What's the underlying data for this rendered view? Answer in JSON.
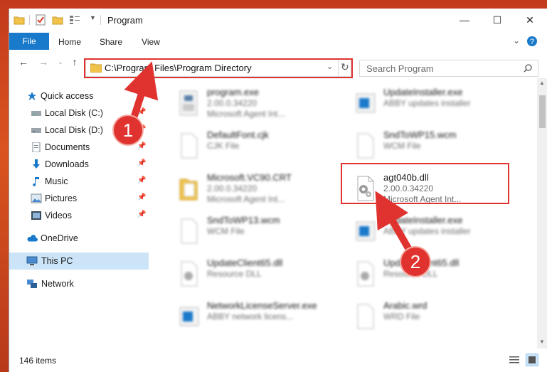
{
  "window": {
    "title": "Program",
    "controls": {
      "minimize": "—",
      "maximize": "☐",
      "close": "✕"
    }
  },
  "ribbon": {
    "tabs": [
      "File",
      "Home",
      "Share",
      "View"
    ],
    "collapse_icon": "chevron-down-icon",
    "help_icon": "help-icon"
  },
  "address": {
    "path": "C:\\Program Files\\Program Directory",
    "search_placeholder": "Search Program"
  },
  "sidebar": {
    "items": [
      {
        "label": "Quick access",
        "icon": "star-icon",
        "pinned": false
      },
      {
        "label": "Local Disk (C:)",
        "icon": "drive-icon",
        "pinned": true
      },
      {
        "label": "Local Disk (D:)",
        "icon": "drive-icon",
        "pinned": true
      },
      {
        "label": "Documents",
        "icon": "documents-icon",
        "pinned": true
      },
      {
        "label": "Downloads",
        "icon": "download-icon",
        "pinned": true
      },
      {
        "label": "Music",
        "icon": "music-icon",
        "pinned": true
      },
      {
        "label": "Pictures",
        "icon": "pictures-icon",
        "pinned": true
      },
      {
        "label": "Videos",
        "icon": "videos-icon",
        "pinned": true
      },
      {
        "label": "OneDrive",
        "icon": "cloud-icon",
        "pinned": false
      },
      {
        "label": "This PC",
        "icon": "computer-icon",
        "pinned": false,
        "selected": true
      },
      {
        "label": "Network",
        "icon": "network-icon",
        "pinned": false
      }
    ]
  },
  "files": {
    "left": [
      {
        "name": "program.exe",
        "line1": "2.00.0.34220",
        "line2": "Microsoft Agent Int..."
      },
      {
        "name": "DefaultFont.cjk",
        "line1": "CJK File",
        "line2": ""
      },
      {
        "name": "Microsoft.VC90.CRT",
        "line1": "2.00.0.34220",
        "line2": "Microsoft Agent Int..."
      },
      {
        "name": "SndToWP13.wcm",
        "line1": "WCM File",
        "line2": ""
      },
      {
        "name": "UpdateClient65.dll",
        "line1": "Resource DLL",
        "line2": ""
      },
      {
        "name": "NetworkLicenseServer.exe",
        "line1": "ABBY network licens...",
        "line2": ""
      }
    ],
    "right": [
      {
        "name": "UpdateInstaller.exe",
        "line1": "ABBY updates installer",
        "line2": ""
      },
      {
        "name": "SndToWP15.wcm",
        "line1": "WCM File",
        "line2": ""
      },
      {
        "name": "agt040b.dll",
        "line1": "2.00.0.34220",
        "line2": "Microsoft Agent Int..."
      },
      {
        "name": "UpdateInstaller.exe",
        "line1": "ABBY updates installer",
        "line2": ""
      },
      {
        "name": "UpdateClient65.dll",
        "line1": "Resource DLL",
        "line2": ""
      },
      {
        "name": "Arabic.wrd",
        "line1": "WRD File",
        "line2": ""
      }
    ]
  },
  "status": {
    "item_count": "146 items"
  },
  "annotations": {
    "step1": "1",
    "step2": "2",
    "color": "#e0332f"
  }
}
